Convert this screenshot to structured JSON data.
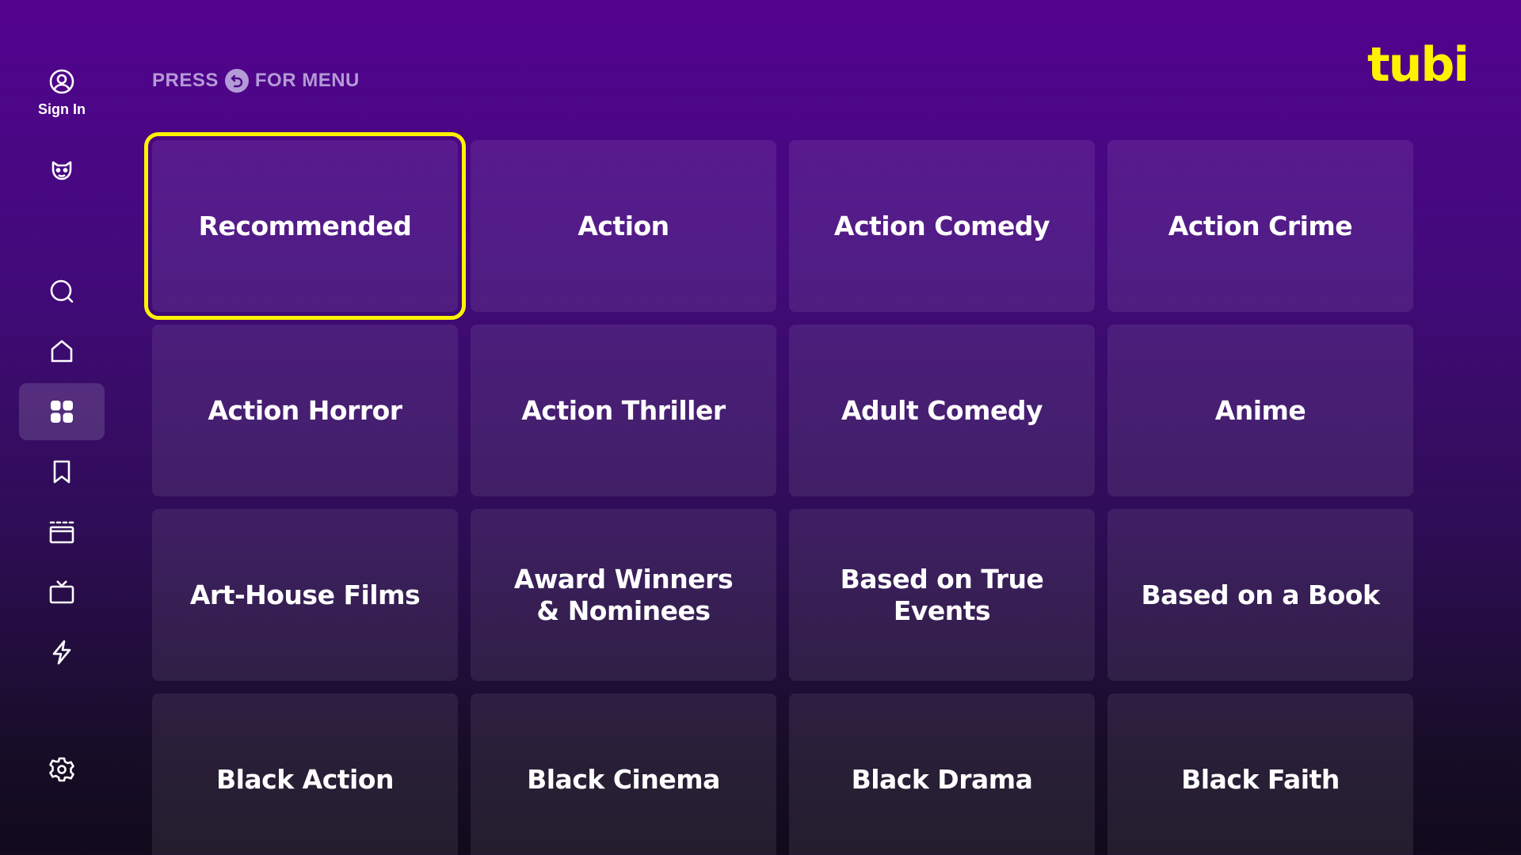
{
  "sidebar": {
    "sign_in_label": "Sign In",
    "items": [
      {
        "name": "kids-mode-icon"
      },
      {
        "name": "search-icon"
      },
      {
        "name": "home-icon"
      },
      {
        "name": "categories-icon"
      },
      {
        "name": "bookmark-icon"
      },
      {
        "name": "movies-icon"
      },
      {
        "name": "tv-icon"
      },
      {
        "name": "live-icon"
      },
      {
        "name": "settings-icon"
      }
    ]
  },
  "header": {
    "hint_prefix": "PRESS",
    "hint_suffix": "FOR MENU",
    "hint_icon": "back-button-icon"
  },
  "brand": {
    "logo_text": "tubi",
    "accent_color": "#fff200"
  },
  "categories": [
    "Recommended",
    "Action",
    "Action Comedy",
    "Action Crime",
    "Action Horror",
    "Action Thriller",
    "Adult Comedy",
    "Anime",
    "Art-House Films",
    "Award Winners & Nominees",
    "Based on True Events",
    "Based on a Book",
    "Black Action",
    "Black Cinema",
    "Black Drama",
    "Black Faith"
  ]
}
